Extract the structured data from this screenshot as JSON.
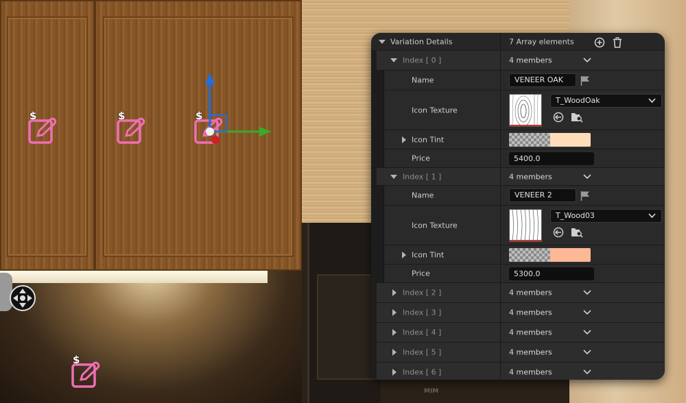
{
  "viewport": {
    "oven_label": "MIM",
    "edit_widgets": [
      {
        "symbol": "$"
      },
      {
        "symbol": "$"
      },
      {
        "symbol": "$"
      },
      {
        "symbol": "$"
      }
    ]
  },
  "panel": {
    "header": {
      "label": "Variation Details",
      "value": "7 Array elements",
      "add_icon": "plus-circle-icon",
      "delete_icon": "trash-icon"
    },
    "elements": [
      {
        "index_label": "Index [ 0 ]",
        "members": "4 members",
        "expanded": true,
        "name_label": "Name",
        "name_value": "VENEER OAK",
        "icon_texture_label": "Icon Texture",
        "texture_name": "T_WoodOak",
        "icon_tint_label": "Icon Tint",
        "tint_color": "#FFDDBB",
        "price_label": "Price",
        "price_value": "5400.0"
      },
      {
        "index_label": "Index [ 1 ]",
        "members": "4 members",
        "expanded": true,
        "name_label": "Name",
        "name_value": "VENEER 2",
        "icon_texture_label": "Icon Texture",
        "texture_name": "T_Wood03",
        "icon_tint_label": "Icon Tint",
        "tint_color": "#FFB896",
        "price_label": "Price",
        "price_value": "5300.0"
      },
      {
        "index_label": "Index [ 2 ]",
        "members": "4 members",
        "expanded": false
      },
      {
        "index_label": "Index [ 3 ]",
        "members": "4 members",
        "expanded": false
      },
      {
        "index_label": "Index [ 4 ]",
        "members": "4 members",
        "expanded": false
      },
      {
        "index_label": "Index [ 5 ]",
        "members": "4 members",
        "expanded": false
      },
      {
        "index_label": "Index [ 6 ]",
        "members": "4 members",
        "expanded": false
      }
    ]
  },
  "colors": {
    "panel_bg": "#242424",
    "widget_pink": "#F06EB4",
    "gizmo_x": "#3AAA2A",
    "gizmo_y": "#1E6FE0",
    "gizmo_z": "#D02020"
  }
}
